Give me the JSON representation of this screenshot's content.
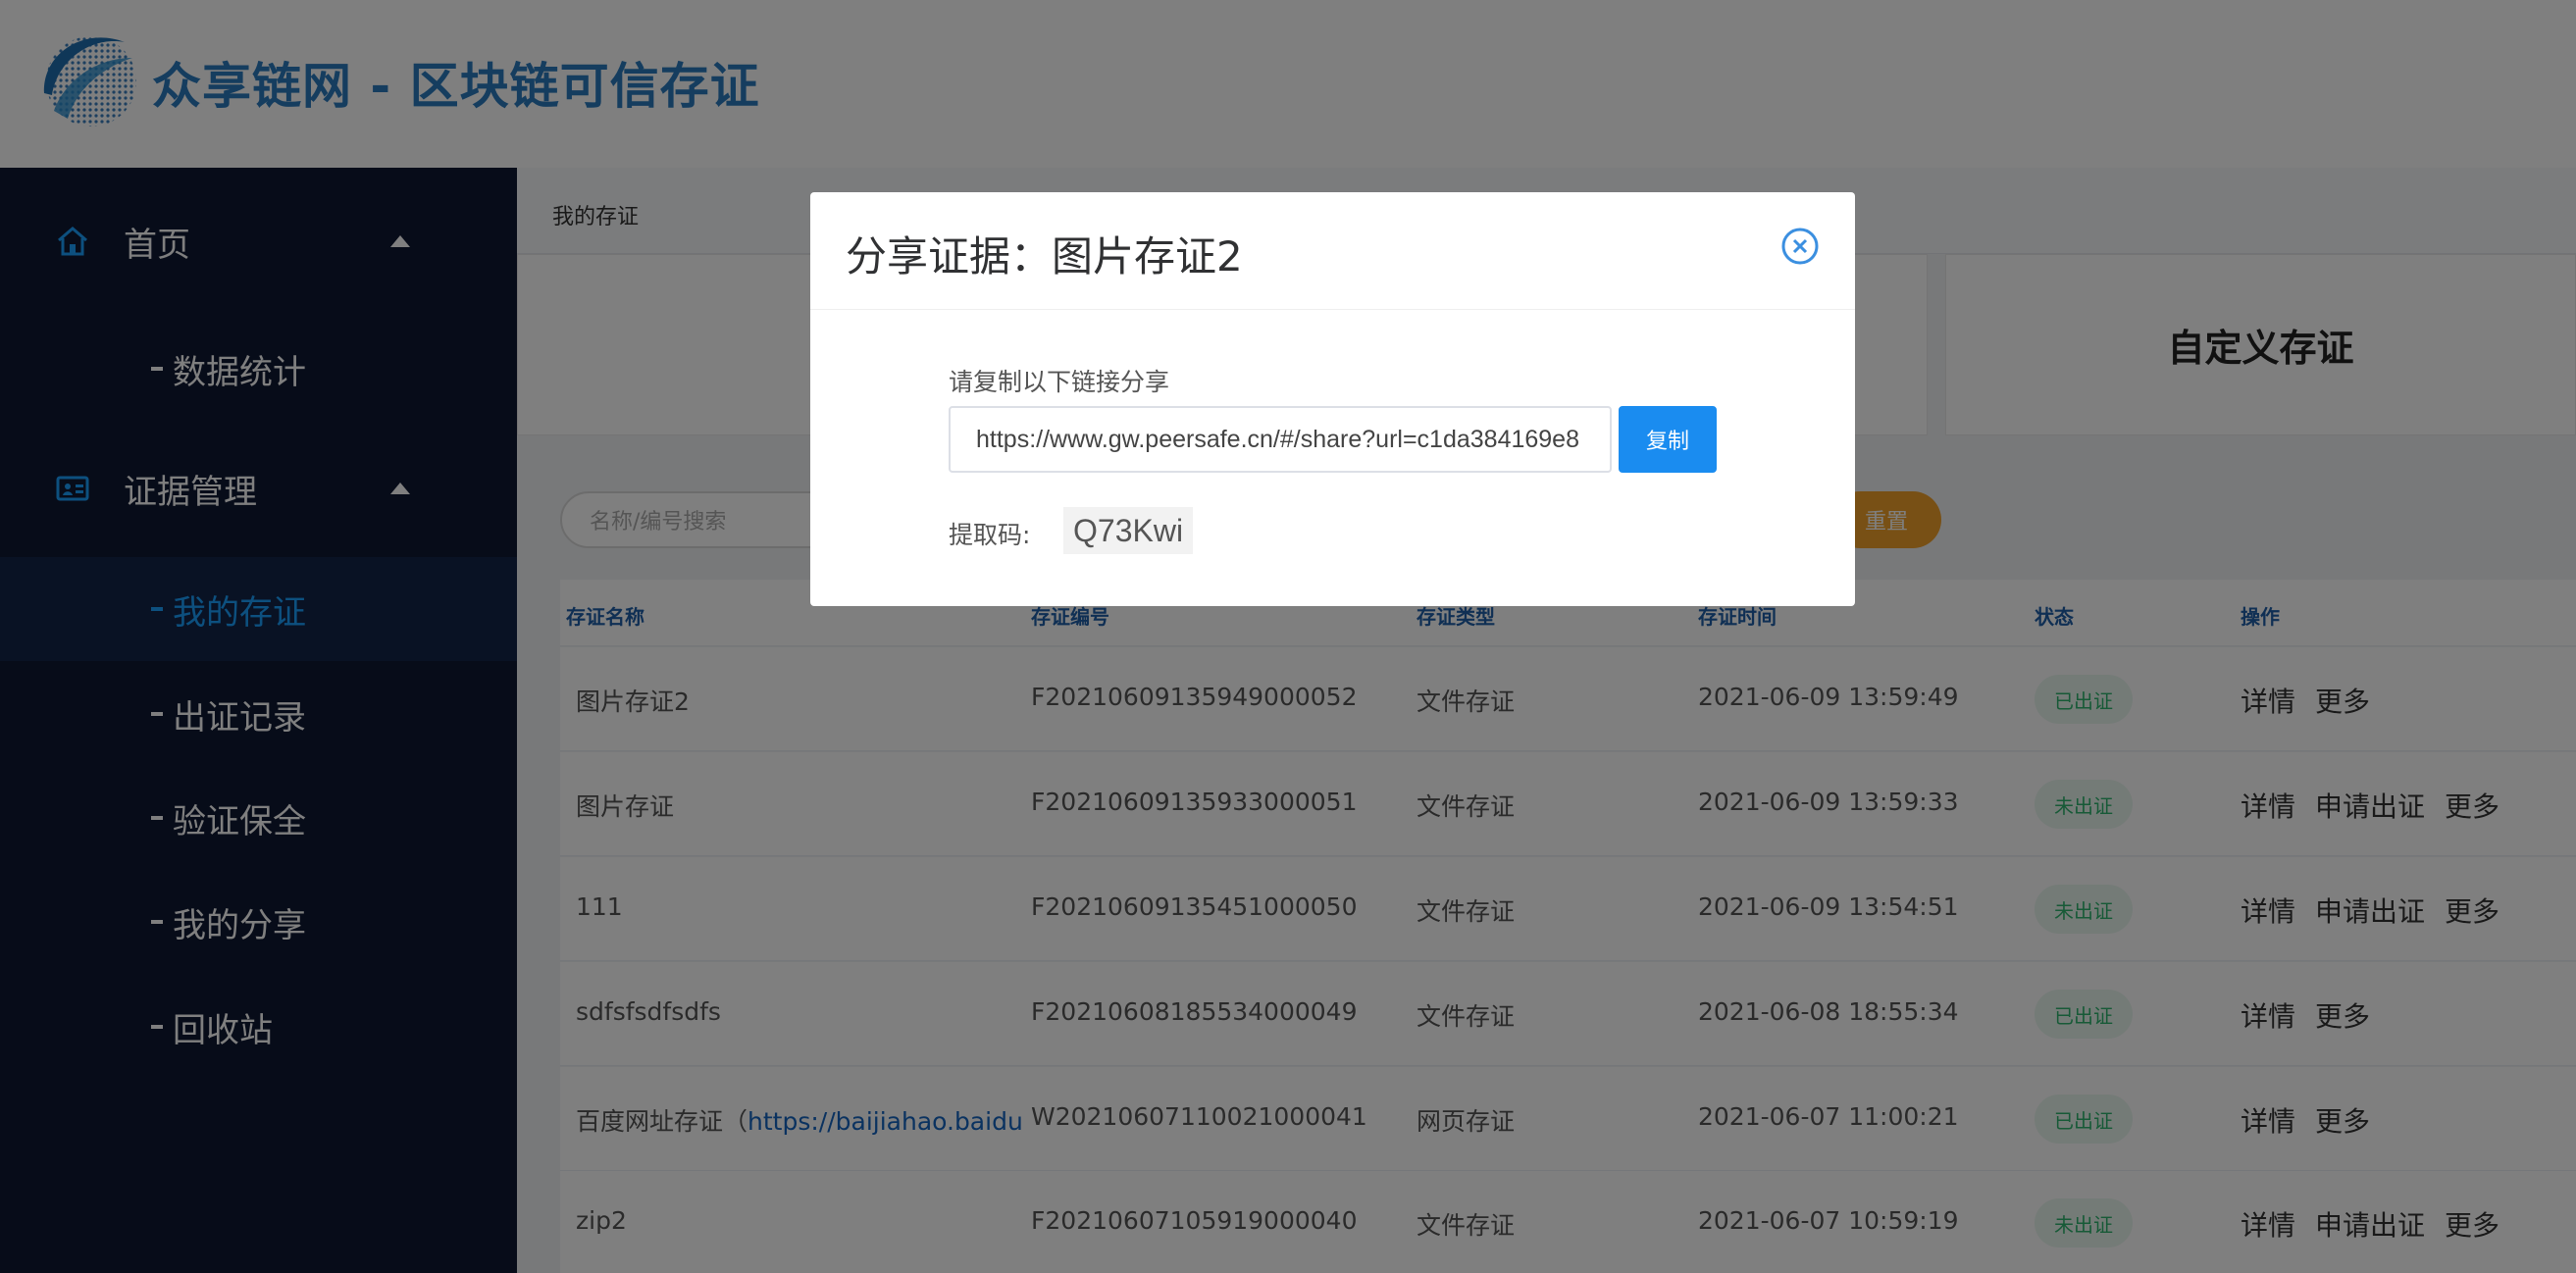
{
  "header": {
    "title": "众享链网 - 区块链可信存证"
  },
  "sidebar": {
    "groups": [
      {
        "label": "首页",
        "icon": "home-icon",
        "items": [
          "数据统计"
        ]
      },
      {
        "label": "证据管理",
        "icon": "id-card-icon",
        "items": [
          "我的存证",
          "出证记录",
          "验证保全",
          "我的分享",
          "回收站"
        ]
      }
    ],
    "active_item": "我的存证"
  },
  "main": {
    "breadcrumb": "我的存证",
    "cards": [
      "",
      "",
      "自定义存证"
    ],
    "search_placeholder": "名称/编号搜索",
    "reset_label": "重置",
    "table": {
      "headers": [
        "存证名称",
        "存证编号",
        "存证类型",
        "存证时间",
        "状态",
        "操作"
      ],
      "rows": [
        {
          "name": "图片存证2",
          "name_link": "",
          "id": "F20210609135949000052",
          "type": "文件存证",
          "time": "2021-06-09 13:59:49",
          "status": "已出证",
          "actions": [
            "详情",
            "更多"
          ]
        },
        {
          "name": "图片存证",
          "name_link": "",
          "id": "F20210609135933000051",
          "type": "文件存证",
          "time": "2021-06-09 13:59:33",
          "status": "未出证",
          "actions": [
            "详情",
            "申请出证",
            "更多"
          ]
        },
        {
          "name": "111",
          "name_link": "",
          "id": "F20210609135451000050",
          "type": "文件存证",
          "time": "2021-06-09 13:54:51",
          "status": "未出证",
          "actions": [
            "详情",
            "申请出证",
            "更多"
          ]
        },
        {
          "name": "sdfsfsdfsdfs",
          "name_link": "",
          "id": "F20210608185534000049",
          "type": "文件存证",
          "time": "2021-06-08 18:55:34",
          "status": "已出证",
          "actions": [
            "详情",
            "更多"
          ]
        },
        {
          "name": "百度网址存证（",
          "name_link": "https://baijiahao.baidu",
          "id": "W20210607110021000041",
          "type": "网页存证",
          "time": "2021-06-07 11:00:21",
          "status": "已出证",
          "actions": [
            "详情",
            "更多"
          ]
        },
        {
          "name": "zip2",
          "name_link": "",
          "id": "F20210607105919000040",
          "type": "文件存证",
          "time": "2021-06-07 10:59:19",
          "status": "未出证",
          "actions": [
            "详情",
            "申请出证",
            "更多"
          ]
        }
      ]
    }
  },
  "modal": {
    "title": "分享证据：图片存证2",
    "share_label": "请复制以下链接分享",
    "share_link": "https://www.gw.peersafe.cn/#/share?url=c1da384169e8",
    "copy_label": "复制",
    "code_label": "提取码:",
    "code_value": "Q73Kwi"
  },
  "colors": {
    "sidebar_bg": "#0f1832",
    "accent": "#1a8cf0",
    "brand": "#2b7bbf",
    "active_text": "#1aa0ff",
    "reset_btn": "#f0a12b",
    "status_green": "#2fb46e"
  }
}
